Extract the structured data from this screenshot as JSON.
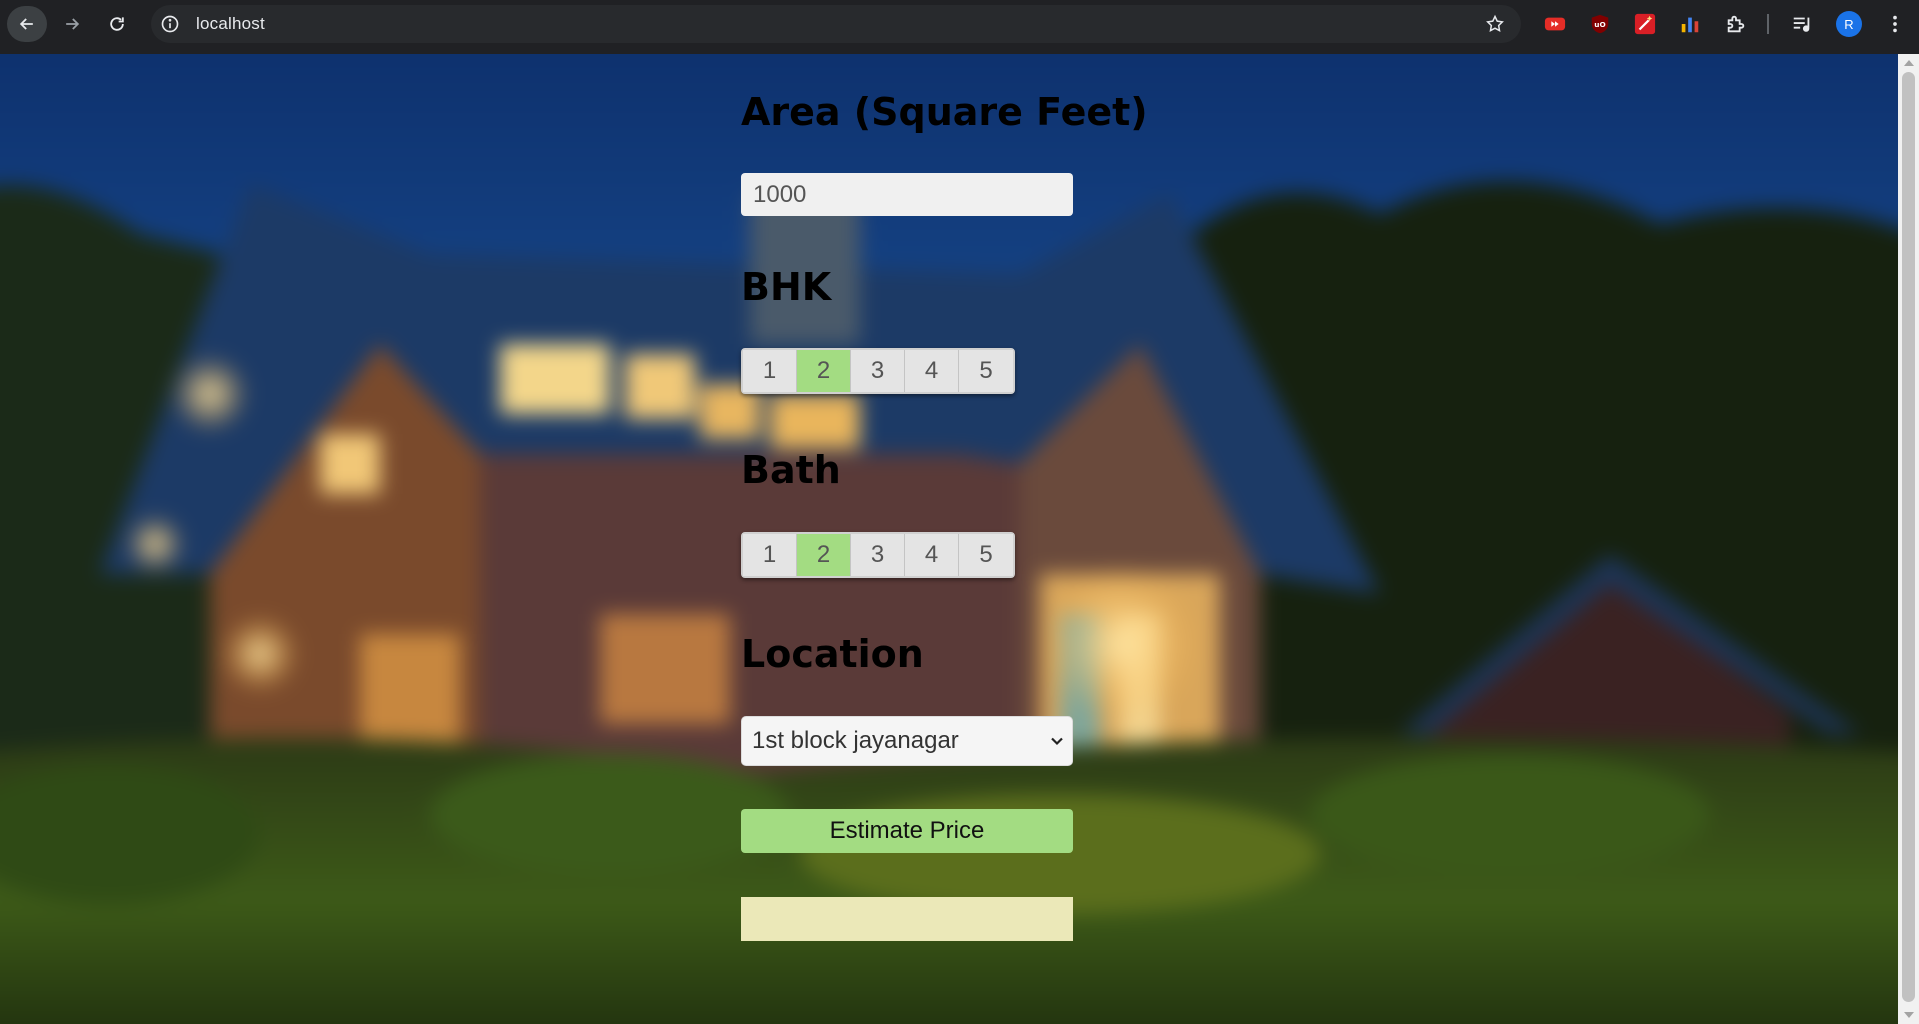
{
  "browser": {
    "url": "localhost",
    "profile_initial": "R",
    "icons": [
      "back-arrow-icon",
      "forward-arrow-icon",
      "reload-icon",
      "site-info-icon",
      "bookmark-star-icon",
      "youtube-extension-icon",
      "ublock-extension-icon",
      "wand-extension-icon",
      "bar-chart-extension-icon",
      "extensions-puzzle-icon",
      "media-control-icon",
      "more-menu-icon"
    ]
  },
  "form": {
    "area_heading": "Area (Square Feet)",
    "area_value": "1000",
    "bhk_heading": "BHK",
    "bhk_options": [
      "1",
      "2",
      "3",
      "4",
      "5"
    ],
    "bhk_selected": "2",
    "bath_heading": "Bath",
    "bath_options": [
      "1",
      "2",
      "3",
      "4",
      "5"
    ],
    "bath_selected": "2",
    "location_heading": "Location",
    "location_selected": "1st block jayanagar",
    "estimate_label": "Estimate Price",
    "result_text": ""
  },
  "colors": {
    "selected_option": "#a3dc82",
    "button": "#a3dc82",
    "result_box": "#ebe8b8"
  }
}
